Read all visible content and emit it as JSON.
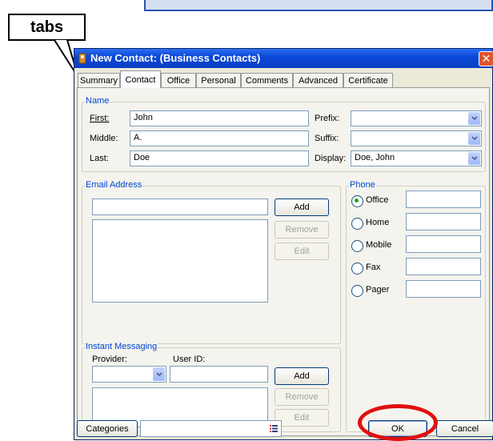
{
  "callout": {
    "label": "tabs"
  },
  "window": {
    "title": "New Contact:  (Business Contacts)",
    "close_glyph": "✕"
  },
  "tabs": [
    {
      "label": "Summary"
    },
    {
      "label": "Contact"
    },
    {
      "label": "Office"
    },
    {
      "label": "Personal"
    },
    {
      "label": "Comments"
    },
    {
      "label": "Advanced"
    },
    {
      "label": "Certificate"
    }
  ],
  "name_group": {
    "title": "Name",
    "first_label": "First:",
    "first_value": "John",
    "middle_label": "Middle:",
    "middle_value": "A.",
    "last_label": "Last:",
    "last_value": "Doe",
    "prefix_label": "Prefix:",
    "prefix_value": "",
    "suffix_label": "Suffix:",
    "suffix_value": "",
    "display_label": "Display:",
    "display_value": "Doe, John"
  },
  "email_group": {
    "title": "Email Address",
    "input_value": "",
    "add_label": "Add",
    "remove_label": "Remove",
    "edit_label": "Edit"
  },
  "im_group": {
    "title": "Instant Messaging",
    "provider_label": "Provider:",
    "userid_label": "User ID:",
    "provider_value": "",
    "userid_value": "",
    "add_label": "Add",
    "remove_label": "Remove",
    "edit_label": "Edit"
  },
  "phone_group": {
    "title": "Phone",
    "options": [
      {
        "label": "Office",
        "selected": true,
        "value": ""
      },
      {
        "label": "Home",
        "selected": false,
        "value": ""
      },
      {
        "label": "Mobile",
        "selected": false,
        "value": ""
      },
      {
        "label": "Fax",
        "selected": false,
        "value": ""
      },
      {
        "label": "Pager",
        "selected": false,
        "value": ""
      }
    ]
  },
  "footer": {
    "categories_label": "Categories",
    "categories_value": "",
    "ok_label": "OK",
    "cancel_label": "Cancel"
  },
  "colors": {
    "title_bar": "#0a48d8",
    "highlight_ring": "#e01010",
    "group_label": "#0046d5"
  }
}
